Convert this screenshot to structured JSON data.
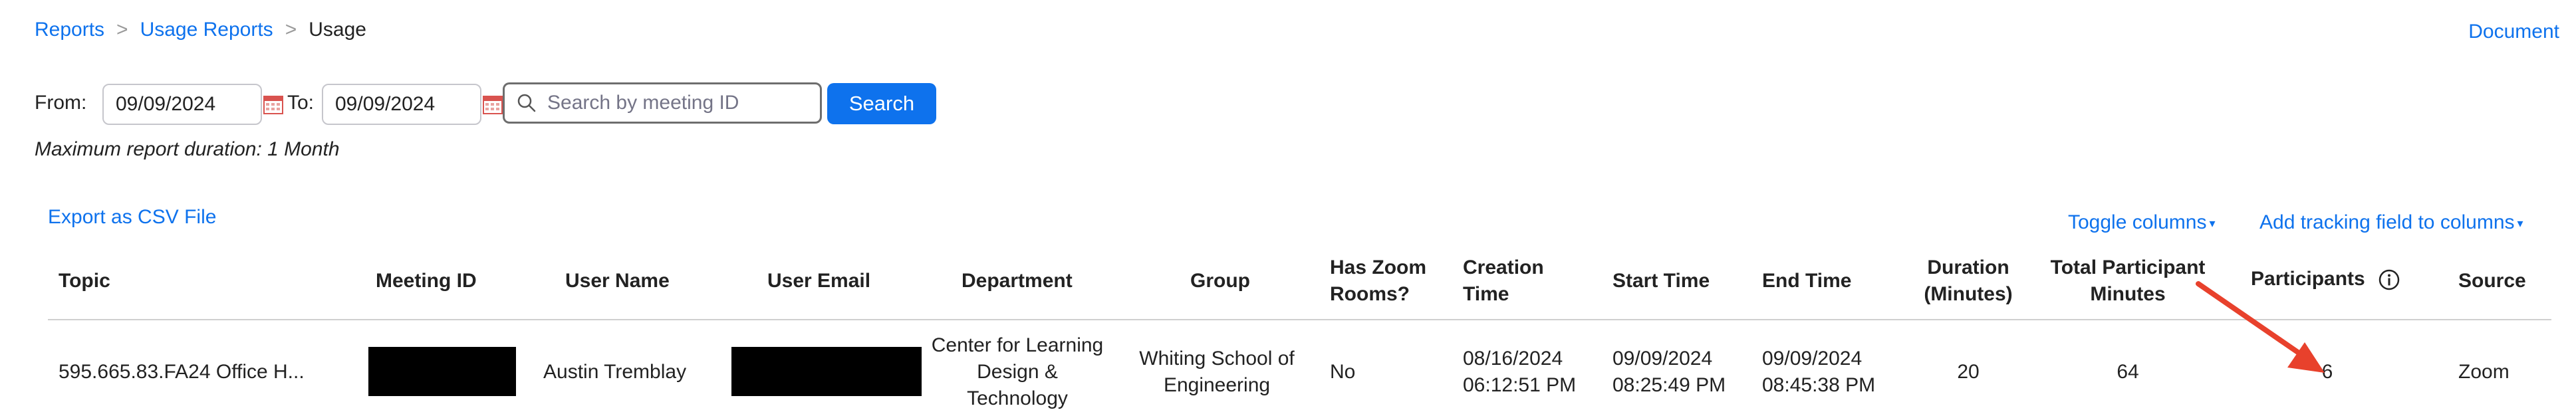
{
  "breadcrumb": {
    "items": [
      {
        "label": "Reports"
      },
      {
        "label": "Usage Reports"
      }
    ],
    "separator": ">",
    "current": "Usage"
  },
  "header": {
    "document_link": "Document"
  },
  "filters": {
    "from_label": "From:",
    "from_value": "09/09/2024",
    "to_label": "To:",
    "to_value": "09/09/2024",
    "search_placeholder": "Search by meeting ID",
    "search_button": "Search",
    "max_duration_note": "Maximum report duration: 1 Month"
  },
  "actions": {
    "export_csv": "Export as CSV File",
    "toggle_columns": "Toggle columns",
    "add_tracking": "Add tracking field to columns"
  },
  "table": {
    "columns": {
      "topic": "Topic",
      "meeting_id": "Meeting ID",
      "user_name": "User Name",
      "user_email": "User Email",
      "department": "Department",
      "group": "Group",
      "has_zoom_rooms_1": "Has Zoom",
      "has_zoom_rooms_2": "Rooms?",
      "creation_time_1": "Creation",
      "creation_time_2": "Time",
      "start_time": "Start Time",
      "end_time": "End Time",
      "duration_1": "Duration",
      "duration_2": "(Minutes)",
      "total_minutes_1": "Total Participant",
      "total_minutes_2": "Minutes",
      "participants": "Participants",
      "source": "Source"
    },
    "rows": [
      {
        "topic": "595.665.83.FA24 Office H...",
        "user_name": "Austin Tremblay",
        "department_1": "Center for Learning",
        "department_2": "Design &",
        "department_3": "Technology",
        "group_1": "Whiting School of",
        "group_2": "Engineering",
        "has_zoom_rooms": "No",
        "creation_date": "08/16/2024",
        "creation_time": "06:12:51 PM",
        "start_date": "09/09/2024",
        "start_time": "08:25:49 PM",
        "end_date": "09/09/2024",
        "end_time": "08:45:38 PM",
        "duration": "20",
        "total_minutes": "64",
        "participants": "6",
        "source": "Zoom"
      }
    ]
  },
  "icons": {
    "calendar": "calendar-icon",
    "search": "search-icon",
    "info": "info-icon",
    "caret": "caret-down-icon",
    "annotation_arrow": "red-arrow-annotation"
  },
  "colors": {
    "link": "#0e72ed",
    "button": "#0e72ed",
    "annotation": "#e8412c",
    "redaction": "#000000"
  }
}
